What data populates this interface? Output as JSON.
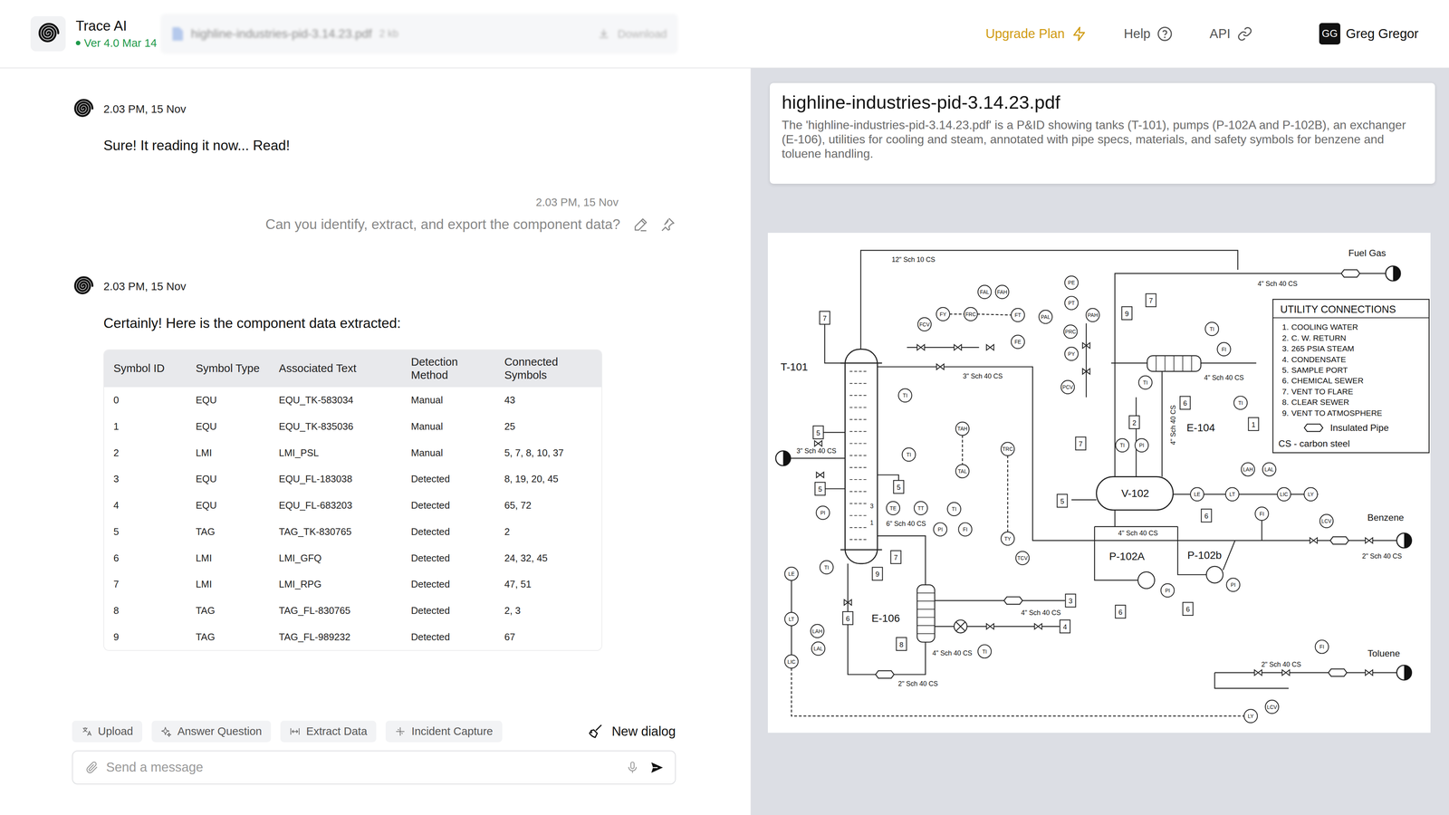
{
  "app": {
    "name": "Trace AI",
    "version": "Ver 4.0 Mar 14"
  },
  "file_chip": {
    "name": "highline-industries-pid-3.14.23.pdf",
    "size": "2 kb",
    "action": "Download"
  },
  "nav": [
    {
      "label": "Upgrade Plan",
      "highlighted": true
    },
    {
      "label": "Help",
      "highlighted": false
    },
    {
      "label": "API",
      "highlighted": false
    }
  ],
  "user": {
    "initials": "GG",
    "name": "Greg Gregor"
  },
  "messages": [
    {
      "sender": "bot",
      "time": "2.03 PM, 15 Nov",
      "text": "Sure! It reading it now... Read!"
    },
    {
      "sender": "user",
      "time": "2.03 PM, 15 Nov",
      "text": "Can you identify, extract, and export the component data?"
    },
    {
      "sender": "bot",
      "time": "2.03 PM, 15 Nov",
      "text": "Certainly! Here is the component data extracted:",
      "table": {
        "columns": [
          "Symbol ID",
          "Symbol Type",
          "Associated Text",
          "Detection Method",
          "Connected Symbols"
        ],
        "rows": [
          [
            "0",
            "EQU",
            "EQU_TK-583034",
            "Manual",
            "43"
          ],
          [
            "1",
            "EQU",
            "EQU_TK-835036",
            "Manual",
            "25"
          ],
          [
            "2",
            "LMI",
            "LMI_PSL",
            "Manual",
            "5, 7, 8, 10, 37"
          ],
          [
            "3",
            "EQU",
            "EQU_FL-183038",
            "Detected",
            "8, 19, 20, 45"
          ],
          [
            "4",
            "EQU",
            "EQU_FL-683203",
            "Detected",
            "65, 72"
          ],
          [
            "5",
            "TAG",
            "TAG_TK-830765",
            "Detected",
            "2"
          ],
          [
            "6",
            "LMI",
            "LMI_GFQ",
            "Detected",
            "24, 32, 45"
          ],
          [
            "7",
            "LMI",
            "LMI_RPG",
            "Detected",
            "47, 51"
          ],
          [
            "8",
            "TAG",
            "TAG_FL-830765",
            "Detected",
            "2, 3"
          ],
          [
            "9",
            "TAG",
            "TAG_FL-989232",
            "Detected",
            "67"
          ]
        ]
      }
    }
  ],
  "actions": [
    "Upload",
    "Answer Question",
    "Extract Data",
    "Incident Capture"
  ],
  "new_dialog": "New dialog",
  "composer": {
    "placeholder": "Send a message"
  },
  "document": {
    "title": "highline-industries-pid-3.14.23.pdf",
    "summary": "The 'highline-industries-pid-3.14.23.pdf' is a P&ID showing tanks (T-101), pumps (P-102A and P-102B), an exchanger (E-106), utilities for cooling and steam, annotated with pipe specs, materials, and safety symbols for benzene and toluene handling.",
    "diagram": {
      "equipment": [
        "T-101",
        "V-102",
        "E-104",
        "E-106",
        "P-102A",
        "P-102b"
      ],
      "streams": [
        "Fuel Gas",
        "Benzene",
        "Toluene"
      ],
      "pipe_specs": [
        "12\" Sch 10 CS",
        "4\" Sch 40 CS",
        "3\" Sch 40 CS",
        "4\" Sch 40 CS",
        "3\" Sch 40 CS",
        "6\" Sch 40 CS",
        "4\" Sch 40 CS",
        "4\" Sch 40 CS",
        "4\" Sch 40 CS",
        "2\" Sch 40 CS",
        "2\" Sch 40 CS",
        "2\" Sch 40 CS",
        "4\" Sch 40 CS"
      ],
      "instruments": [
        "FAL",
        "FAH",
        "FY",
        "FRC",
        "FT",
        "FCV",
        "FE",
        "PE",
        "PT",
        "PAL",
        "PAH",
        "PRC",
        "PY",
        "PCV",
        "TI",
        "FI",
        "TI",
        "TI",
        "TI",
        "TAH",
        "TAL",
        "TRC",
        "TI",
        "TI",
        "PI",
        "LAH",
        "LAL",
        "LE",
        "LT",
        "LIC",
        "LY",
        "LCV",
        "FI",
        "TE",
        "TT",
        "TI",
        "PI",
        "FI",
        "TY",
        "TCV",
        "PI",
        "TI",
        "LE",
        "LT",
        "LAH",
        "LAL",
        "LIC",
        "TI",
        "PI",
        "PI",
        "FI",
        "LCV",
        "LY"
      ],
      "line_numbers": [
        "7",
        "5",
        "5",
        "5",
        "6",
        "7",
        "9",
        "8",
        "3",
        "4",
        "9",
        "7",
        "2",
        "6",
        "1",
        "7",
        "5",
        "6",
        "6",
        "6"
      ],
      "tray_marks": [
        "3",
        "1"
      ],
      "legend": {
        "title": "UTILITY CONNECTIONS",
        "items": [
          {
            "number": "1.",
            "label": "COOLING WATER"
          },
          {
            "number": "2.",
            "label": "C. W. RETURN"
          },
          {
            "number": "3.",
            "label": "265 PSIA STEAM"
          },
          {
            "number": "4.",
            "label": "CONDENSATE"
          },
          {
            "number": "5.",
            "label": "SAMPLE PORT"
          },
          {
            "number": "6.",
            "label": "CHEMICAL SEWER"
          },
          {
            "number": "7.",
            "label": "VENT TO FLARE"
          },
          {
            "number": "8.",
            "label": "CLEAR SEWER"
          },
          {
            "number": "9.",
            "label": "VENT TO ATMOSPHERE"
          }
        ],
        "insulated": "Insulated Pipe",
        "material": "CS - carbon steel"
      }
    }
  }
}
